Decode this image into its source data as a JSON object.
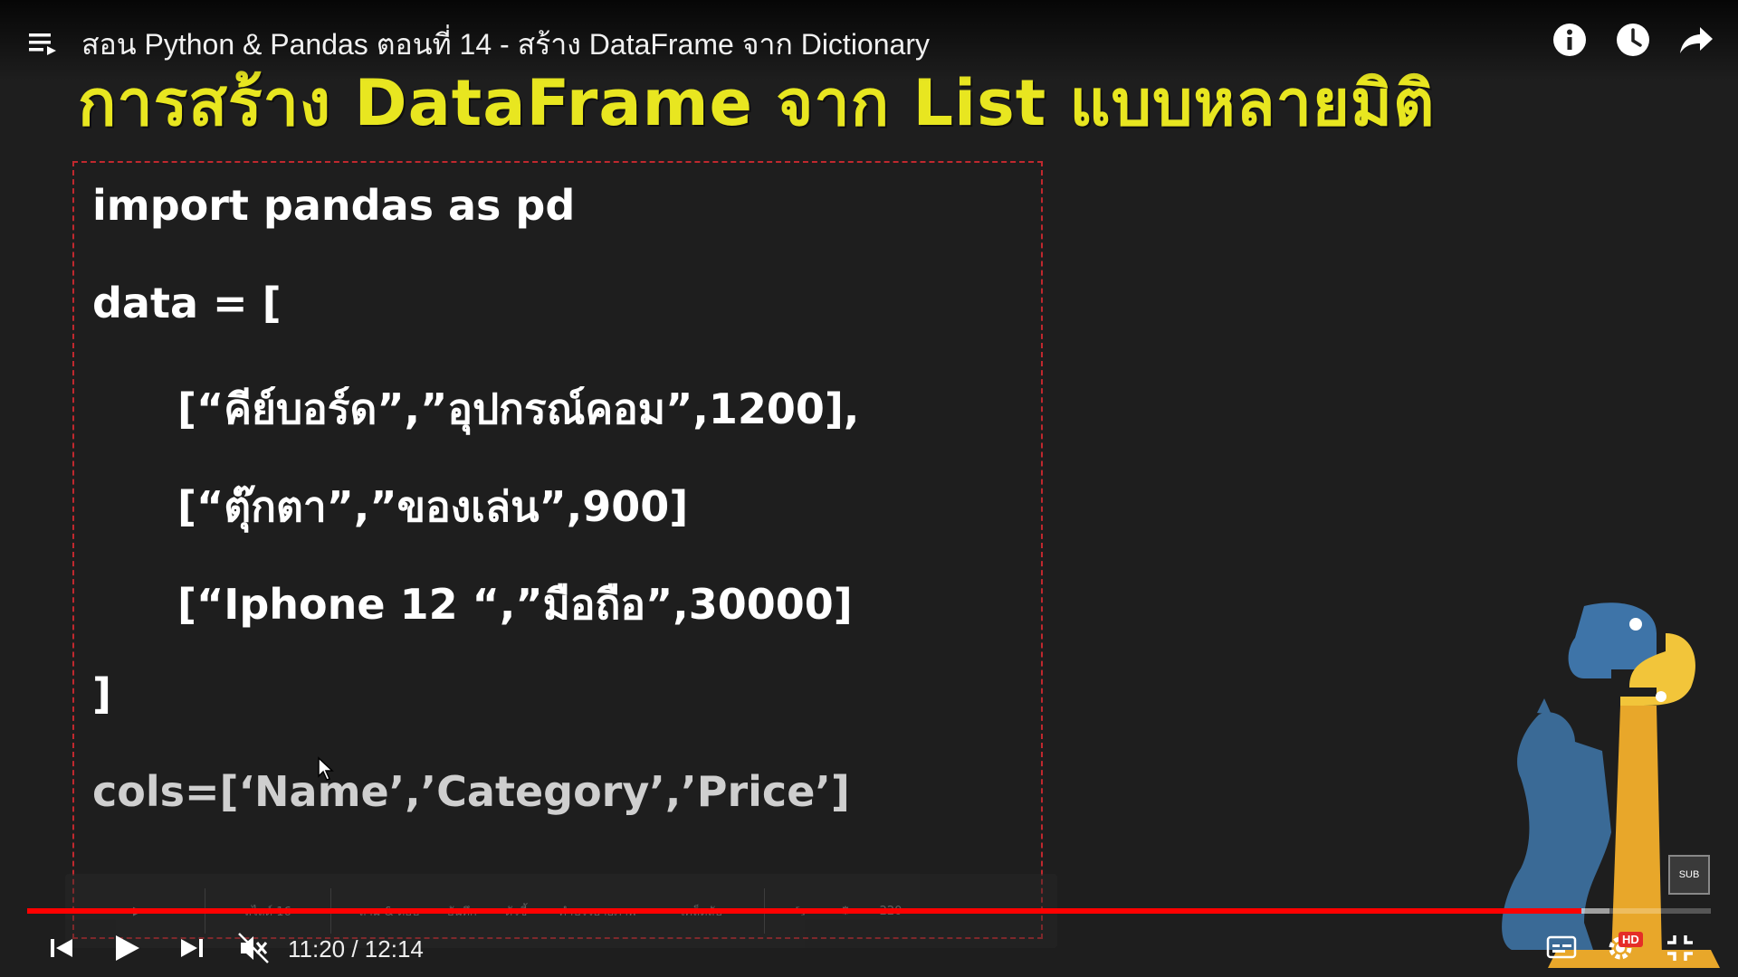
{
  "player": {
    "title": "สอน Python & Pandas ตอนที่ 14 - สร้าง DataFrame จาก Dictionary",
    "current_time": "11:20",
    "duration": "12:14",
    "time_display": "11:20 / 12:14",
    "progress_fraction": 0.923,
    "buffered_fraction": 0.94,
    "hd_label": "HD",
    "sub_label": "SUB"
  },
  "slide": {
    "heading": "การสร้าง DataFrame จาก List แบบหลายมิติ",
    "code_lines": [
      "import pandas as pd",
      "data = [",
      "[“คีย์บอร์ด”,”อุปกรณ์คอม”,1200],",
      "[“ตุ๊กตา”,”ของเล่น”,900]",
      "[“Iphone 12 “,”มือถือ”,30000]",
      "]",
      "cols=[‘Name’,’Category’,’Price’]"
    ]
  },
  "slide_toolbar": {
    "slide_label": "สไลด์ 16",
    "items": [
      "ถาม & ตอบ",
      "บันทึก",
      "ตัวชี้",
      "คำบรรยายภาพ",
      "เคล็ดลับ"
    ],
    "zoom": "220"
  },
  "colors": {
    "heading": "#e8e620",
    "progress": "#ff0000",
    "code_border": "#c0282e"
  }
}
